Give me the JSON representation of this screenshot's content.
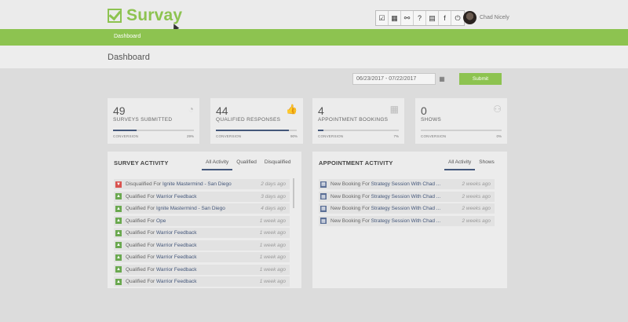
{
  "app": {
    "name": "Survay"
  },
  "header": {
    "toolbar_icons": [
      "checkbox-icon",
      "calendar-icon",
      "link-icon",
      "help-icon",
      "book-icon",
      "facebook-icon",
      "power-icon"
    ],
    "toolbar_glyphs": [
      "☑",
      "▦",
      "⚯",
      "?",
      "▤",
      "f",
      "⏻"
    ],
    "user_name": "Chad Nicely"
  },
  "nav": {
    "dashboard": "Dashboard"
  },
  "page": {
    "title": "Dashboard"
  },
  "filters": {
    "date_range": "06/23/2017 - 07/22/2017",
    "submit_label": "Submit"
  },
  "stats": [
    {
      "value": "49",
      "label": "SURVEYS SUBMITTED",
      "footer": "CONVERSION",
      "percent": "29%",
      "fill": 0.29,
      "icon": "pie-chart-icon",
      "glyph": "◔"
    },
    {
      "value": "44",
      "label": "QUALIFIED RESPONSES",
      "footer": "CONVERSION",
      "percent": "90%",
      "fill": 0.9,
      "icon": "thumbs-up-icon",
      "glyph": "👍"
    },
    {
      "value": "4",
      "label": "APPOINTMENT BOOKINGS",
      "footer": "CONVERSION",
      "percent": "7%",
      "fill": 0.07,
      "icon": "calendar-icon",
      "glyph": "▦"
    },
    {
      "value": "0",
      "label": "SHOWS",
      "footer": "CONVERSION",
      "percent": "0%",
      "fill": 0.0,
      "icon": "user-icon",
      "glyph": "⚇"
    }
  ],
  "survey_activity": {
    "title": "SURVEY ACTIVITY",
    "tabs": [
      "All Activity",
      "Qualified",
      "Disqualified"
    ],
    "rows": [
      {
        "status": "Disqualified For",
        "link": "Ignite Mastermind - San Diego",
        "time": "2 days ago",
        "kind": "down"
      },
      {
        "status": "Qualified For",
        "link": "Warrior Feedback",
        "time": "3 days ago",
        "kind": "up"
      },
      {
        "status": "Qualified For",
        "link": "Ignite Mastermind - San Diego",
        "time": "4 days ago",
        "kind": "up"
      },
      {
        "status": "Qualified For",
        "link": "Ope",
        "time": "1 week ago",
        "kind": "up"
      },
      {
        "status": "Qualified For",
        "link": "Warrior Feedback",
        "time": "1 week ago",
        "kind": "up"
      },
      {
        "status": "Qualified For",
        "link": "Warrior Feedback",
        "time": "1 week ago",
        "kind": "up"
      },
      {
        "status": "Qualified For",
        "link": "Warrior Feedback",
        "time": "1 week ago",
        "kind": "up"
      },
      {
        "status": "Qualified For",
        "link": "Warrior Feedback",
        "time": "1 week ago",
        "kind": "up"
      },
      {
        "status": "Qualified For",
        "link": "Warrior Feedback",
        "time": "1 week ago",
        "kind": "up"
      }
    ]
  },
  "appointment_activity": {
    "title": "APPOINTMENT ACTIVITY",
    "tabs": [
      "All Activity",
      "Shows"
    ],
    "rows": [
      {
        "status": "New Booking For",
        "link": "Strategy Session With Chad ...",
        "time": "2 weeks ago"
      },
      {
        "status": "New Booking For",
        "link": "Strategy Session With Chad ...",
        "time": "2 weeks ago"
      },
      {
        "status": "New Booking For",
        "link": "Strategy Session With Chad ...",
        "time": "2 weeks ago"
      },
      {
        "status": "New Booking For",
        "link": "Strategy Session With Chad ...",
        "time": "2 weeks ago"
      }
    ]
  },
  "colors": {
    "brand_green": "#8dc350",
    "accent_navy": "#44577a",
    "thumb_up": "#6aa84f",
    "thumb_down": "#d9534f",
    "calendar_blue": "#5b6f96"
  }
}
